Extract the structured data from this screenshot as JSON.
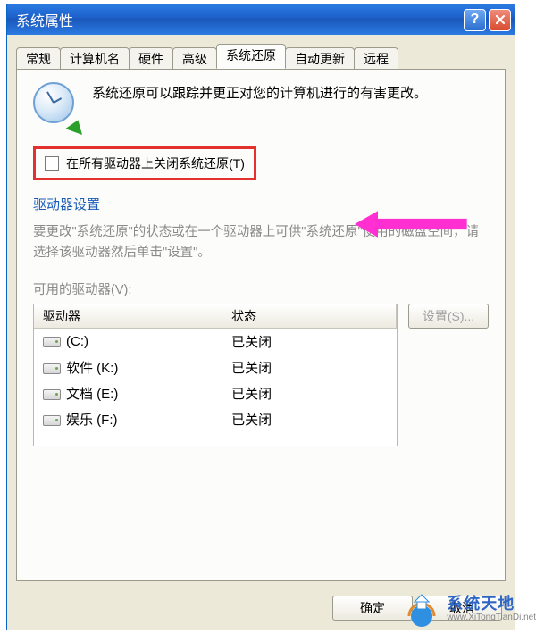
{
  "window": {
    "title": "系统属性"
  },
  "tabs": [
    {
      "label": "常规"
    },
    {
      "label": "计算机名"
    },
    {
      "label": "硬件"
    },
    {
      "label": "高级"
    },
    {
      "label": "系统还原",
      "active": true
    },
    {
      "label": "自动更新"
    },
    {
      "label": "远程"
    }
  ],
  "intro": {
    "text": "系统还原可以跟踪并更正对您的计算机进行的有害更改。"
  },
  "checkbox": {
    "label": "在所有驱动器上关闭系统还原(T)",
    "checked": false
  },
  "group": {
    "title": "驱动器设置",
    "desc": "要更改\"系统还原\"的状态或在一个驱动器上可供\"系统还原\"使用的磁盘空间，请选择该驱动器然后单击\"设置\"。",
    "available_label": "可用的驱动器(V):"
  },
  "drive_table": {
    "headers": {
      "drive": "驱动器",
      "status": "状态"
    },
    "rows": [
      {
        "name": "(C:)",
        "status": "已关闭"
      },
      {
        "name": "软件 (K:)",
        "status": "已关闭"
      },
      {
        "name": "文档 (E:)",
        "status": "已关闭"
      },
      {
        "name": "娱乐 (F:)",
        "status": "已关闭"
      }
    ]
  },
  "buttons": {
    "settings": "设置(S)...",
    "ok": "确定",
    "cancel": "取消"
  },
  "watermark": {
    "brand": {
      "zh": "系统天地",
      "en": "www.XiTongTianDi.net"
    }
  }
}
